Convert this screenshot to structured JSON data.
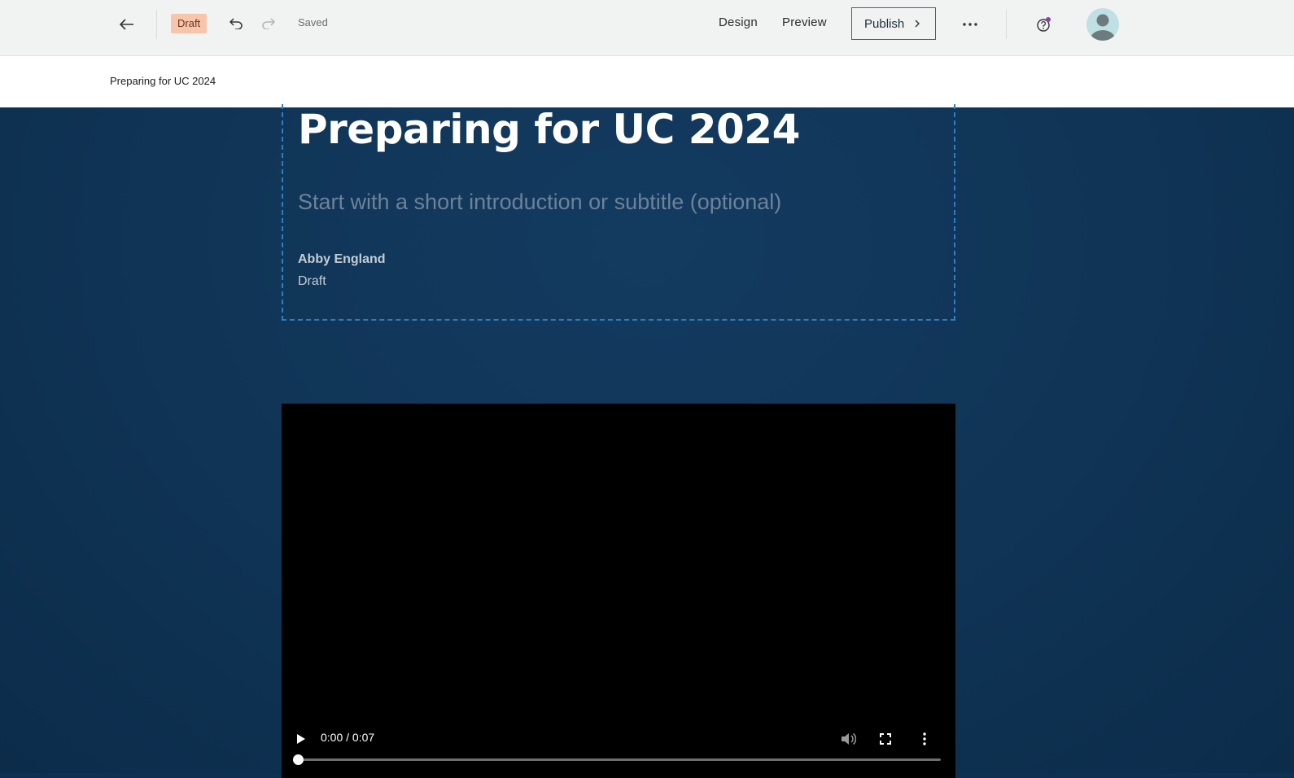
{
  "toolbar": {
    "status_badge": "Draft",
    "save_status": "Saved",
    "nav": {
      "design": "Design",
      "preview": "Preview"
    },
    "publish_label": "Publish",
    "accent_color": "#1d6ea5",
    "notification_color": "#8e3fa8"
  },
  "header": {
    "story_title": "Preparing for UC 2024"
  },
  "story": {
    "title": "Preparing for UC 2024",
    "subtitle_placeholder": "Start with a short introduction or subtitle (optional)",
    "author": "Abby England",
    "status": "Draft"
  },
  "video": {
    "time": "0:00 / 0:07",
    "progress_fraction": 0
  },
  "icons": [
    "back-arrow-icon",
    "undo-icon",
    "redo-icon",
    "more-icon",
    "help-icon",
    "user-avatar-icon",
    "play-icon",
    "volume-icon",
    "fullscreen-icon",
    "video-more-icon"
  ]
}
